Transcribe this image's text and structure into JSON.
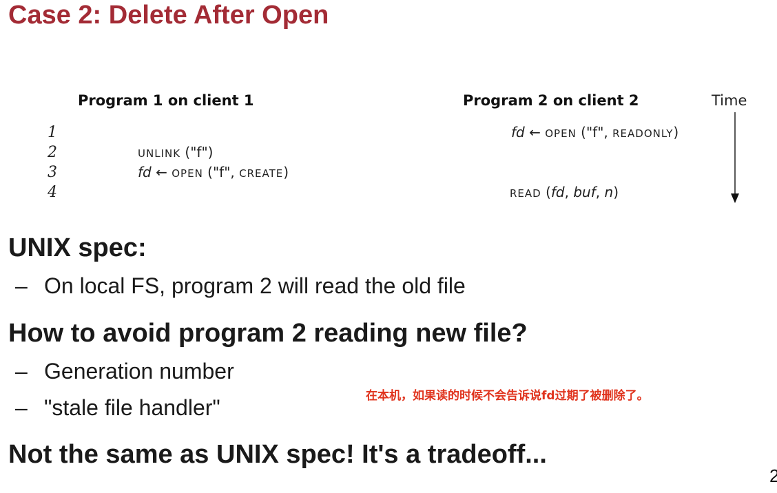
{
  "title": "Case 2: Delete After Open",
  "figure": {
    "col1_header": "Program 1 on client 1",
    "col2_header": "Program 2 on client 2",
    "time_label": "Time",
    "line_numbers": [
      "1",
      "2",
      "3",
      "4"
    ],
    "p2_line1": {
      "var": "fd",
      "arrow": "←",
      "op": "OPEN",
      "args_open": " (\"f\", ",
      "flag": "READONLY",
      "args_close": ")"
    },
    "p1_line2": {
      "op": "UNLINK",
      "args": " (\"f\")"
    },
    "p1_line3": {
      "var": "fd",
      "arrow": "←",
      "op": "OPEN",
      "args_open": " (\"f\", ",
      "flag": "CREATE",
      "args_close": ")"
    },
    "p2_line4": {
      "op": "READ",
      "open_paren": " (",
      "a1": "fd",
      "sep1": ", ",
      "a2": "buf",
      "sep2": ", ",
      "a3": "n",
      "close_paren": ")"
    }
  },
  "sections": {
    "unix_heading": "UNIX spec:",
    "unix_bullet": "On local FS, program 2 will read the old file",
    "avoid_heading": "How to avoid program 2 reading new file?",
    "avoid_bullet1": "Generation number",
    "avoid_bullet2": "\"stale file handler\"",
    "conclusion": "Not the same as UNIX spec! It's a tradeoff..."
  },
  "bullet_dash": "–",
  "annotation": "在本机，如果读的时候不会告诉说fd过期了被删除了。",
  "page_number": "2",
  "colors": {
    "title": "#a32b35",
    "annotation": "#e0341e"
  }
}
